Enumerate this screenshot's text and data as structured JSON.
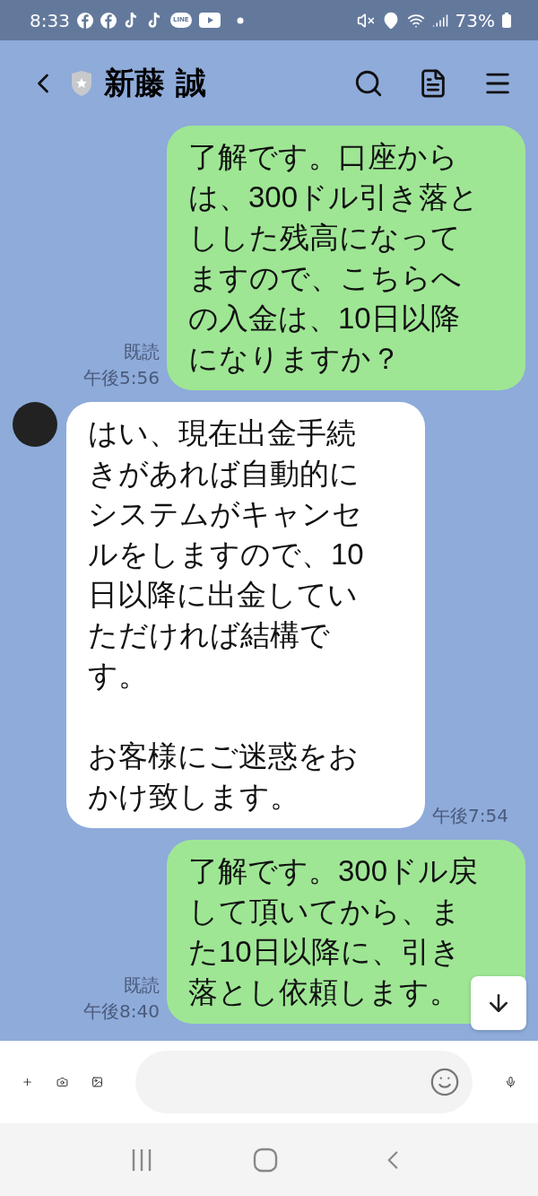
{
  "status_bar": {
    "time": "8:33",
    "notification_icons": [
      {
        "kind": "facebook"
      },
      {
        "kind": "facebook"
      },
      {
        "kind": "tiktok"
      },
      {
        "kind": "tiktok"
      },
      {
        "kind": "line",
        "label": "LINE"
      },
      {
        "kind": "youtube"
      },
      {
        "kind": "dot"
      }
    ],
    "battery": "73%"
  },
  "header": {
    "title": "新藤 誠"
  },
  "messages": [
    {
      "kind": "sent",
      "paragraphs": [
        "了解です。口座からは、300ドル引き落としした残高になってますので、こちらへの入金は、10日以降になりますか？"
      ],
      "read": "既読",
      "time": "午後5:56"
    },
    {
      "kind": "received",
      "paragraphs": [
        "はい、現在出金手続きがあれば自動的にシステムがキャンセルをしますので、10日以降に出金していただければ結構です。",
        "お客様にご迷惑をおかけ致します。"
      ],
      "time": "午後7:54"
    },
    {
      "kind": "sent",
      "paragraphs": [
        "了解です。300ドル戻して頂いてから、また10日以降に、引き落とし依頼します。"
      ],
      "read": "既読",
      "time": "午後8:40"
    }
  ]
}
